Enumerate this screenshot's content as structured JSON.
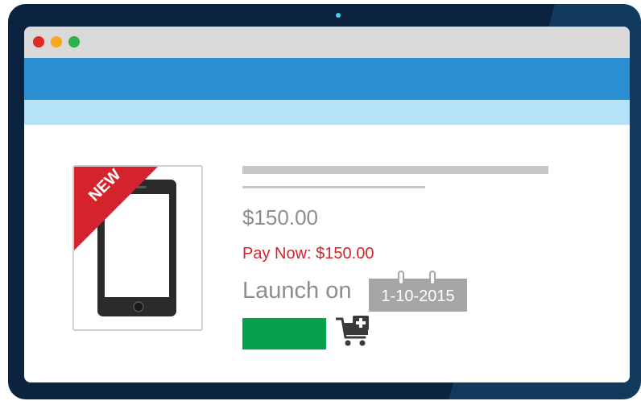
{
  "browser": {
    "window_controls": [
      "close",
      "minimize",
      "maximize"
    ],
    "colors": {
      "close": "#e02a2a",
      "minimize": "#f6a81b",
      "maximize": "#2bb24c"
    }
  },
  "product": {
    "badge": "NEW",
    "image_icon": "smartphone-icon",
    "price": "$150.00",
    "pay_now": "Pay Now: $150.00",
    "launch_label": "Launch on",
    "launch_date": "1-10-2015",
    "buy_button_label": "",
    "cart_icon": "add-to-cart-icon"
  },
  "colors": {
    "nav_blue": "#2a8fd2",
    "subnav_light_blue": "#b5e2f7",
    "badge_red": "#d4232b",
    "button_green": "#07a14d",
    "price_gray": "#8d8d8d",
    "pay_now_red": "#d4232b"
  }
}
